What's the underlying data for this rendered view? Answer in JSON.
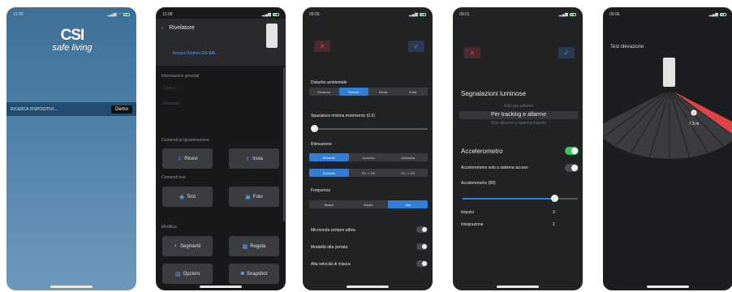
{
  "p1": {
    "time": "12:08",
    "logo_top": "CSI",
    "logo_sub": "safe living",
    "search_label": "RICERCA DISPOSITIVI...",
    "demo_button": "Demo"
  },
  "p2": {
    "time": "12:08",
    "back_title": "Rivelatore",
    "device_name": "Innova Outdoor RS WA",
    "sec_info": "Informazioni generali",
    "info_line1": "Codice",
    "info_line2": "Firmware",
    "sec_prog": "Comandi programmazione",
    "btn_receive": "Ricevi",
    "btn_send": "Invia",
    "sec_test": "Comandi test",
    "btn_test": "Test",
    "btn_photo": "Foto",
    "sec_mod": "Modifica",
    "btn_segments": "Segmenti",
    "btn_rule": "Regola",
    "btn_options": "Opzioni",
    "btn_snapshot": "Snapshot"
  },
  "p3": {
    "time": "09:00",
    "disturbo_label": "Disturbo ambientale",
    "disturbo_opts": [
      "Nessuno",
      "Debole",
      "Medio",
      "Forte"
    ],
    "spaz_label": "Spaziatura minima movimento (0.5)",
    "rilev_label": "Rilevazione",
    "rilev_opts1": [
      "Entrante",
      "Avvicina",
      "Allontana"
    ],
    "rilev_opts2": [
      "Entrante",
      "SX -> DX",
      "DX -> SX"
    ],
    "freq_label": "Frequenza",
    "freq_opts": [
      "Bassa",
      "Media",
      "Alta"
    ],
    "tog1": "Microonda sempre attiva",
    "tog2": "Modalità alta portata",
    "tog3": "Alta velocità di misura"
  },
  "p4": {
    "time": "09:01",
    "segn_label": "Segnalazioni luminose",
    "picker_top": "Solo per allarme",
    "picker_sel": "Per tracking e allarme",
    "picker_bot": "Solo allarme a sistema inserito",
    "acc_label": "Accelerometro",
    "acc_sys_label": "Accelerometro solo a sistema acceso",
    "acc_val_label": "Accelerometro (80)",
    "impulsi_label": "Impulsi",
    "impulsi_val": "3",
    "integr_label": "Integrazione",
    "integr_val": "2"
  },
  "p5": {
    "time": "09:06",
    "title": "Test rilevazione",
    "target_id": "2",
    "target_dist": "7.3 m"
  },
  "colors": {
    "accent_blue": "#2f7ed8",
    "toggle_green": "#34c759",
    "danger_red": "#e04545"
  }
}
